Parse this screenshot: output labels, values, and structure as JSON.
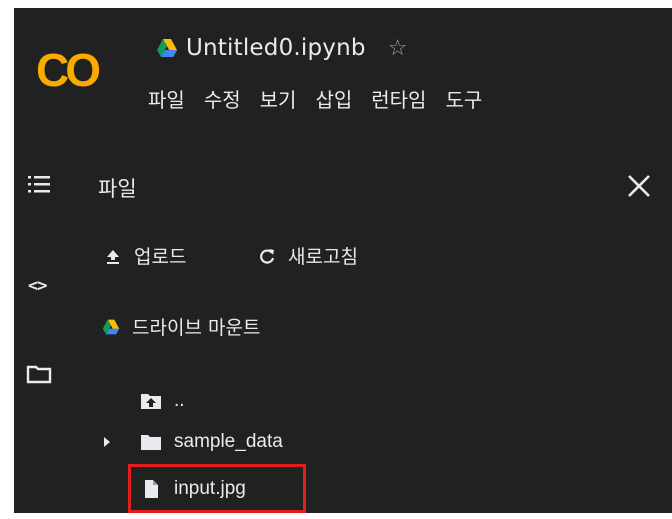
{
  "app": {
    "logo_text": "CO",
    "notebook_title": "Untitled0.ipynb"
  },
  "icons": {
    "logo": "colab-logo",
    "drive": "google-drive-icon",
    "star": "star-outline-icon",
    "toc": "table-of-contents-icon",
    "code": "code-snippets-icon",
    "folder": "folder-icon",
    "close": "close-icon",
    "upload": "upload-icon",
    "refresh": "refresh-icon",
    "caret": "caret-right-icon",
    "file": "file-icon"
  },
  "menu": [
    "파일",
    "수정",
    "보기",
    "삽입",
    "런타임",
    "도구"
  ],
  "files_panel": {
    "title": "파일",
    "actions": {
      "upload": "업로드",
      "refresh": "새로고침",
      "mount_drive": "드라이브 마운트"
    },
    "tree": [
      {
        "name": "..",
        "type": "parent-folder"
      },
      {
        "name": "sample_data",
        "type": "folder",
        "expanded": false
      },
      {
        "name": "input.jpg",
        "type": "file",
        "highlighted": true
      }
    ]
  },
  "colors": {
    "background": "#212121",
    "text": "#e8eaed",
    "logo_orange": "#f9ab00",
    "highlight_box": "#e31c1c"
  }
}
